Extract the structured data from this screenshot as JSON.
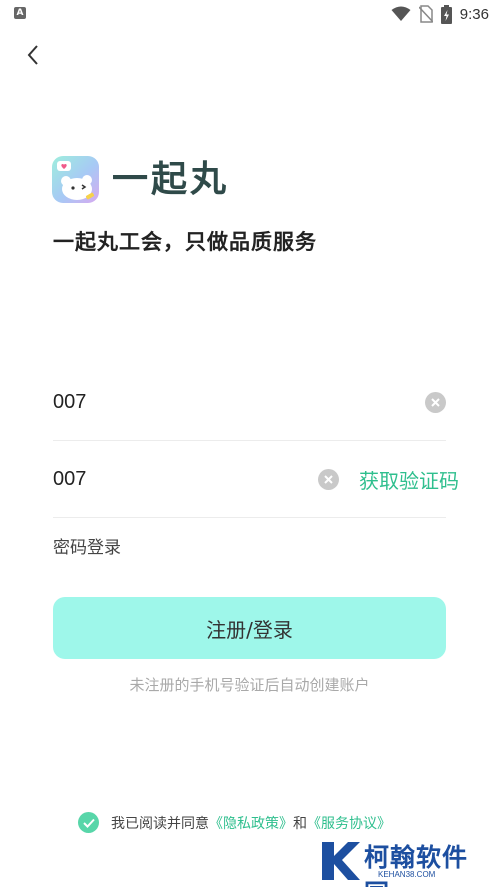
{
  "status_bar": {
    "notification_icon": "a-notification-icon",
    "notification_letter": "A",
    "time": "9:36"
  },
  "brand": {
    "name": "一起丸",
    "slogan": "一起丸工会，只做品质服务"
  },
  "form": {
    "phone_value": "007",
    "code_value": "007",
    "get_code_label": "获取验证码",
    "password_login_label": "密码登录",
    "submit_label": "注册/登录",
    "hint": "未注册的手机号验证后自动创建账户"
  },
  "agreement": {
    "checked": true,
    "prefix": "我已阅读并同意",
    "privacy_link": "《隐私政策》",
    "conjunction": "和",
    "service_link": "《服务协议》"
  },
  "watermark": {
    "text": "柯翰软件园",
    "sub": "KEHAN38.COM"
  },
  "colors": {
    "accent": "#2fbf8e",
    "button_bg": "#9ef7ea",
    "brand_text": "#2f4a49",
    "check_bg": "#58d6a9"
  }
}
